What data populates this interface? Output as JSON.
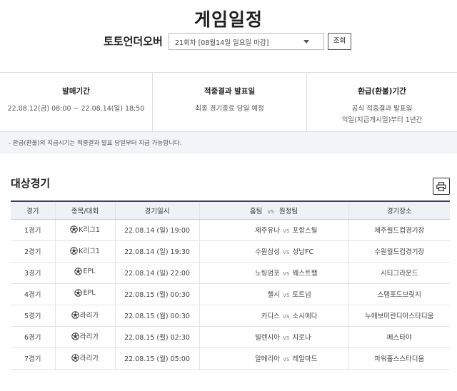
{
  "page": {
    "title": "게임일정"
  },
  "selector": {
    "game_name": "토토언더오버",
    "round": "21회차 [08월14일 일요일 마감]",
    "search_label": "조회"
  },
  "info": [
    {
      "head": "발매기간",
      "lines": [
        "22.08.12(금) 08:00 ~ 22.08.14(일) 18:50"
      ]
    },
    {
      "head": "적중결과 발표일",
      "lines": [
        "최종 경기종료 당일 예정"
      ]
    },
    {
      "head": "환급(환불)기간",
      "lines": [
        "공식 적중결과 발표일",
        "익일(지급개시일)부터 1년간"
      ]
    }
  ],
  "notice": "- 환급(환불)의 지급시기는 적중결과 발표 당일부터 지급 가능합니다.",
  "section_title": "대상경기",
  "table": {
    "headers": [
      "경기",
      "종목/대회",
      "경기일시",
      "홈팀",
      "vs",
      "원정팀",
      "경기장소"
    ],
    "rows": [
      {
        "no": "1경기",
        "league": "K리그1",
        "datetime": "22.08.14 (일) 19:00",
        "home": "제주유나",
        "vs": "vs",
        "away": "포항스틸",
        "venue": "제주월드컵경기장"
      },
      {
        "no": "2경기",
        "league": "K리그1",
        "datetime": "22.08.14 (일) 19:30",
        "home": "수원삼성",
        "vs": "vs",
        "away": "성남FC",
        "venue": "수원월드컵경기장"
      },
      {
        "no": "3경기",
        "league": "EPL",
        "datetime": "22.08.14 (일) 22:00",
        "home": "노팅엄포",
        "vs": "vs",
        "away": "웨스트햄",
        "venue": "시티그라운드"
      },
      {
        "no": "4경기",
        "league": "EPL",
        "datetime": "22.08.15 (월) 00:30",
        "home": "첼시",
        "vs": "vs",
        "away": "토트넘",
        "venue": "스탬포드브릿지"
      },
      {
        "no": "5경기",
        "league": "라리가",
        "datetime": "22.08.15 (월) 00:30",
        "home": "카디스",
        "vs": "vs",
        "away": "소시에다",
        "venue": "누에보미란디아스타디움"
      },
      {
        "no": "6경기",
        "league": "라리가",
        "datetime": "22.08.15 (월) 02:30",
        "home": "빌렌시아",
        "vs": "vs",
        "away": "지로나",
        "venue": "메스타야"
      },
      {
        "no": "7경기",
        "league": "라리가",
        "datetime": "22.08.15 (월) 05:00",
        "home": "알메리아",
        "vs": "vs",
        "away": "레알마드",
        "venue": "파워홀스스타디움"
      }
    ]
  }
}
